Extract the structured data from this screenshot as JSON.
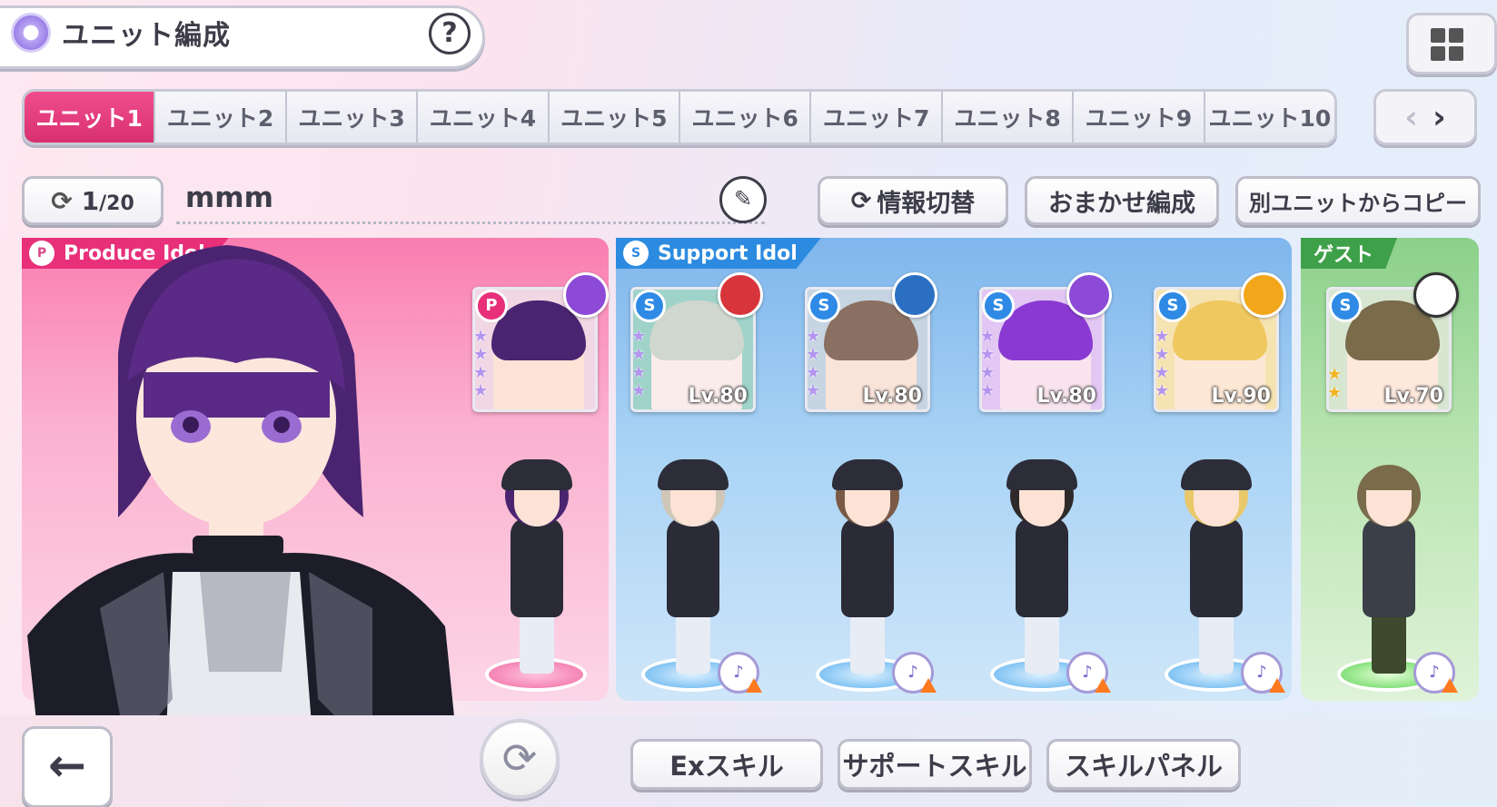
{
  "header": {
    "title": "ユニット編成",
    "help": "?"
  },
  "tabs": [
    "ユニット1",
    "ユニット2",
    "ユニット3",
    "ユニット4",
    "ユニット5",
    "ユニット6",
    "ユニット7",
    "ユニット8",
    "ユニット9",
    "ユニット10"
  ],
  "active_tab": "ユニット1",
  "pager": {
    "prev": "‹",
    "next": "›"
  },
  "unit": {
    "counter_current": "1",
    "counter_total": "/20",
    "name": "mmm"
  },
  "actions": {
    "info_switch": "情報切替",
    "auto": "おまかせ編成",
    "copy": "別ユニットからコピー"
  },
  "sections": {
    "produce": "Produce Idol",
    "support": "Support Idol",
    "guest": "ゲスト"
  },
  "cards": {
    "produce": {
      "type": "P"
    },
    "support": [
      {
        "level": "Lv.80",
        "badge_color": "#d8343b",
        "hair": "#cfd7cf",
        "bg": "#9fd3c9"
      },
      {
        "level": "Lv.80",
        "badge_color": "#2a6fc2",
        "hair": "#8a7062",
        "bg": "#c7d5e2"
      },
      {
        "level": "Lv.80",
        "badge_color": "#8c4ad6",
        "hair": "#8a3ad2",
        "bg": "#e2c7f3"
      },
      {
        "level": "Lv.90",
        "badge_color": "#f2a61a",
        "hair": "#f0c860",
        "bg": "#f6e3b2"
      }
    ],
    "guest": {
      "level": "Lv.70",
      "hair": "#7a6b4a",
      "bg": "#d7e6d0"
    }
  },
  "colors": {
    "accent": "#e8307a",
    "support": "#2c8be0",
    "guest": "#3fa04a"
  },
  "bottom": {
    "back": "←",
    "ex_skill": "Exスキル",
    "support_skill": "サポートスキル",
    "skill_panel": "スキルパネル"
  }
}
